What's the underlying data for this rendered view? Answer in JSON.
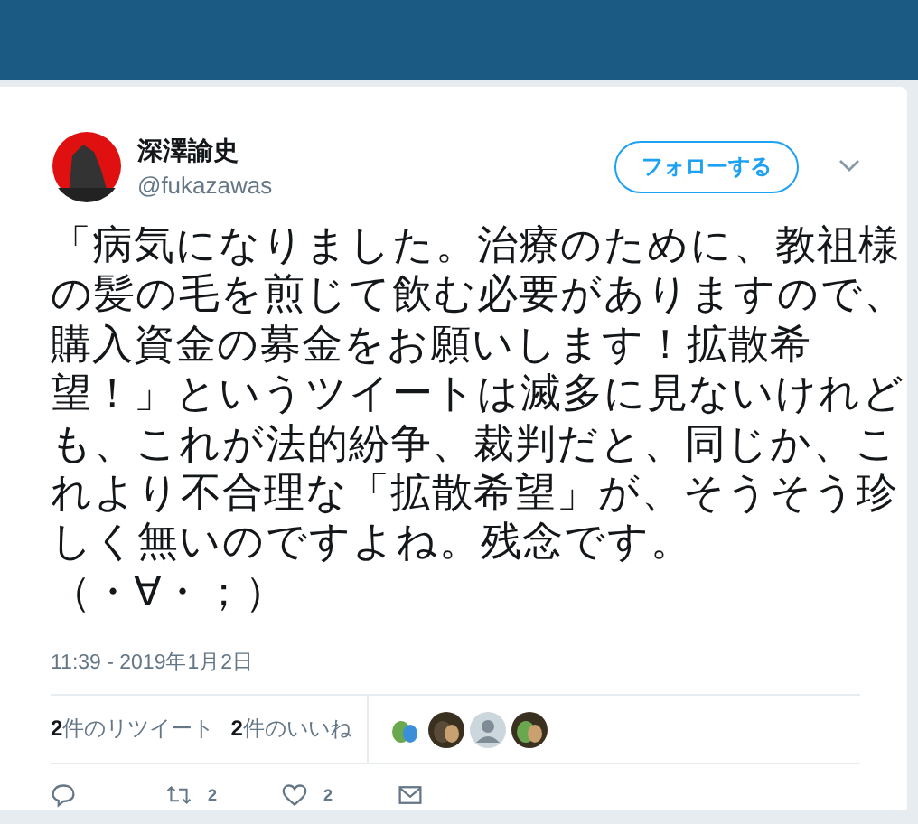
{
  "author": {
    "name": "深澤諭史",
    "handle": "@fukazawas"
  },
  "follow_button": "フォローする",
  "tweet_text": [
    "「病気になりました。治療のために、教祖様の髪の毛を煎じて飲む必要がありますので、購入資金の募金をお願いします！拡散希望！」というツイートは滅多に見ないけれども、これが法的紛争、裁判だと、同じか、これより不合理な「拡散希望」が、そうそう珍しく無いのですよね。残念です。",
    "（・∀・；）"
  ],
  "timestamp": "11:39 - 2019年1月2日",
  "stats": [
    "**2**件のリツイート",
    "**2**件のいいね"
  ],
  "likers": [
    {
      "kind": "picture"
    },
    {
      "kind": "picture"
    },
    {
      "kind": "default"
    },
    {
      "kind": "picture"
    }
  ],
  "actions": [
    {
      "kind": "reply"
    },
    {
      "kind": "retweet",
      "count": "2"
    },
    {
      "kind": "like",
      "count": "2"
    },
    {
      "kind": "message"
    }
  ]
}
